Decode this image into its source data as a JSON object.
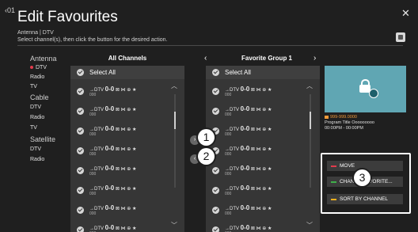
{
  "header": {
    "back_label": "‹01",
    "title": "Edit Favourites",
    "breadcrumb": "Antenna | DTV",
    "instruction": "Select channel(s), then click the button for the desired action.",
    "close_icon": "close-icon",
    "menu_icon": "menu-icon"
  },
  "sidebar": {
    "groups": [
      {
        "label": "Antenna",
        "items": [
          {
            "label": "DTV",
            "selected": true
          },
          {
            "label": "Radio"
          },
          {
            "label": "TV"
          }
        ]
      },
      {
        "label": "Cable",
        "items": [
          {
            "label": "DTV"
          },
          {
            "label": "Radio"
          },
          {
            "label": "TV"
          }
        ]
      },
      {
        "label": "Satellite",
        "items": [
          {
            "label": "DTV"
          },
          {
            "label": "Radio"
          }
        ]
      }
    ]
  },
  "all_channels": {
    "title": "All Channels",
    "select_all": "Select All",
    "rows": [
      {
        "prefix": "→DTV",
        "number": "0-0",
        "name": "000",
        "icons": "⊠ ⋈ ⊕ ★"
      },
      {
        "prefix": "→DTV",
        "number": "0-0",
        "name": "000",
        "icons": "⊠ ⋈ ⊕ ★"
      },
      {
        "prefix": "→DTV",
        "number": "0-0",
        "name": "000",
        "icons": "⊠ ⋈ ⊕ ★"
      },
      {
        "prefix": "→DTV",
        "number": "0-0",
        "name": "000",
        "icons": "⊠ ⋈ ⊕ ★"
      },
      {
        "prefix": "→DTV",
        "number": "0-0",
        "name": "000",
        "icons": "⊠ ⋈ ⊕ ★"
      },
      {
        "prefix": "→DTV",
        "number": "0-0",
        "name": "000",
        "icons": "⊠ ⋈ ⊕ ★"
      },
      {
        "prefix": "→DTV",
        "number": "0-0",
        "name": "000",
        "icons": "⊠ ⋈ ⊕ ★"
      },
      {
        "prefix": "→DTV",
        "number": "0-0",
        "name": "000",
        "icons": "⊠ ⋈ ⊕ ★"
      }
    ]
  },
  "favorite_group": {
    "title": "Favorite Group 1",
    "select_all": "Select All",
    "rows": [
      {
        "prefix": "→DTV",
        "number": "0-0",
        "name": "000",
        "icons": "⊠ ⋈ ⊕ ★"
      },
      {
        "prefix": "→DTV",
        "number": "0-0",
        "name": "000",
        "icons": "⊠ ⋈ ⊕ ★"
      },
      {
        "prefix": "→DTV",
        "number": "0-0",
        "name": "000",
        "icons": "⊠ ⋈ ⊕ ★"
      },
      {
        "prefix": "→DTV",
        "number": "0-0",
        "name": "000",
        "icons": "⊠ ⋈ ⊕ ★"
      },
      {
        "prefix": "→DTV",
        "number": "0-0",
        "name": "000",
        "icons": "⊠ ⋈ ⊕ ★"
      },
      {
        "prefix": "→DTV",
        "number": "0-0",
        "name": "000",
        "icons": "⊠ ⋈ ⊕ ★"
      },
      {
        "prefix": "→DTV",
        "number": "0-0",
        "name": "000",
        "icons": "⊠ ⋈ ⊕ ★"
      },
      {
        "prefix": "→DTV",
        "number": "0-0",
        "name": "000",
        "icons": "⊠ ⋈ ⊕ ★"
      }
    ]
  },
  "transfer": {
    "add_glyph": "›",
    "remove_glyph": "‹"
  },
  "callouts": [
    "1",
    "2",
    "3"
  ],
  "preview": {
    "channel_line": "999-999.0000",
    "program_title": "Program Title Ooooooooo",
    "time": "00:00PM - 00:00PM"
  },
  "actions": [
    {
      "label": "MOVE",
      "color": "#e23b4c"
    },
    {
      "label": "CHANGE FAVORITE...",
      "color": "#3fb04a"
    },
    {
      "label": "SORT BY CHANNEL",
      "color": "#f2b11e"
    }
  ],
  "colors": {
    "background": "#1f1f1f",
    "panel": "#363636",
    "preview": "#60a6b3",
    "accent_red": "#e23b4c",
    "accent_orange": "#f19a39"
  }
}
